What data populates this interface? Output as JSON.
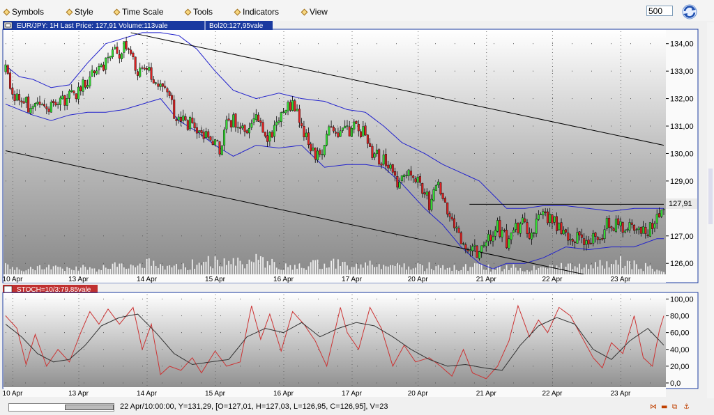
{
  "menu": {
    "items": [
      {
        "label": "Symbols"
      },
      {
        "label": "Style"
      },
      {
        "label": "Time Scale"
      },
      {
        "label": "Tools"
      },
      {
        "label": "Indicators"
      },
      {
        "label": "View"
      }
    ],
    "bars_value": "500"
  },
  "price_panel": {
    "info_label": "EUR/JPY: 1H Last Price: 127,91 Volume:113vale",
    "bol_label": "Bol20:127,95vale",
    "last_price_tag": "127,91"
  },
  "stoch_panel": {
    "info_label": "STOCH=10/3:79,85vale"
  },
  "status": {
    "text": "22 Apr/10:00:00, Y=131,29, [O=127,01, H=127,03, L=126,95, C=126,95], V=23"
  },
  "colors": {
    "up_candle": "#33dd33",
    "down_candle": "#dd2222",
    "bollinger": "#2222cc",
    "panel_border": "#1a3aa0",
    "stoch_fast": "#cc3333",
    "stoch_slow": "#333333"
  },
  "chart_data": [
    {
      "type": "candlestick",
      "x_tick_labels": [
        "10 Apr",
        "13 Apr",
        "14 Apr",
        "15 Apr",
        "16 Apr",
        "17 Apr",
        "20 Apr",
        "21 Apr",
        "22 Apr",
        "23 Apr"
      ],
      "y_tick_labels": [
        "134,00",
        "133,00",
        "132,00",
        "131,00",
        "130,00",
        "129,00",
        "127,00",
        "126,00"
      ],
      "ylim": [
        125.6,
        134.5
      ],
      "last_price": 127.91,
      "close_path": [
        [
          0,
          133.0
        ],
        [
          3,
          132.0
        ],
        [
          8,
          131.9
        ],
        [
          12,
          131.6
        ],
        [
          18,
          131.75
        ],
        [
          25,
          131.85
        ],
        [
          32,
          132.3
        ],
        [
          40,
          133.0
        ],
        [
          47,
          133.6
        ],
        [
          52,
          133.8
        ],
        [
          55,
          133.9
        ],
        [
          58,
          132.9
        ],
        [
          62,
          133.2
        ],
        [
          66,
          132.5
        ],
        [
          70,
          132.4
        ],
        [
          74,
          131.5
        ],
        [
          78,
          131.2
        ],
        [
          84,
          131.0
        ],
        [
          90,
          130.4
        ],
        [
          94,
          130.2
        ],
        [
          98,
          131.3
        ],
        [
          104,
          130.9
        ],
        [
          110,
          131.2
        ],
        [
          116,
          130.6
        ],
        [
          122,
          131.6
        ],
        [
          126,
          131.9
        ],
        [
          130,
          130.9
        ],
        [
          134,
          130.3
        ],
        [
          138,
          129.8
        ],
        [
          142,
          130.8
        ],
        [
          148,
          130.7
        ],
        [
          153,
          131.0
        ],
        [
          158,
          130.7
        ],
        [
          162,
          129.9
        ],
        [
          167,
          129.7
        ],
        [
          172,
          129.0
        ],
        [
          176,
          129.2
        ],
        [
          181,
          129.1
        ],
        [
          186,
          128.2
        ],
        [
          190,
          128.7
        ],
        [
          193,
          128.0
        ],
        [
          197,
          127.4
        ],
        [
          201,
          126.6
        ],
        [
          204,
          126.3
        ],
        [
          208,
          126.5
        ],
        [
          212,
          126.8
        ],
        [
          216,
          127.4
        ],
        [
          220,
          126.8
        ],
        [
          224,
          127.2
        ],
        [
          228,
          127.5
        ],
        [
          231,
          127.0
        ],
        [
          234,
          127.9
        ],
        [
          237,
          127.7
        ],
        [
          241,
          127.5
        ],
        [
          245,
          127.1
        ],
        [
          249,
          127.0
        ],
        [
          253,
          126.9
        ],
        [
          257,
          127.0
        ],
        [
          260,
          126.6
        ],
        [
          264,
          127.6
        ],
        [
          268,
          127.4
        ],
        [
          272,
          127.2
        ],
        [
          277,
          127.3
        ],
        [
          281,
          127.0
        ],
        [
          284,
          127.5
        ],
        [
          287,
          127.8
        ],
        [
          289,
          127.91
        ]
      ],
      "upper_band_path": [
        [
          0,
          133.2
        ],
        [
          6,
          132.8
        ],
        [
          12,
          132.7
        ],
        [
          20,
          132.4
        ],
        [
          28,
          132.5
        ],
        [
          36,
          133.3
        ],
        [
          44,
          134.0
        ],
        [
          52,
          134.2
        ],
        [
          60,
          134.4
        ],
        [
          68,
          134.4
        ],
        [
          76,
          134.3
        ],
        [
          84,
          133.8
        ],
        [
          92,
          133.0
        ],
        [
          100,
          132.3
        ],
        [
          110,
          132.0
        ],
        [
          120,
          132.2
        ],
        [
          130,
          132.0
        ],
        [
          140,
          131.9
        ],
        [
          150,
          131.6
        ],
        [
          158,
          131.5
        ],
        [
          166,
          131.0
        ],
        [
          174,
          130.4
        ],
        [
          184,
          130.0
        ],
        [
          192,
          129.6
        ],
        [
          200,
          129.3
        ],
        [
          208,
          129.0
        ],
        [
          214,
          128.5
        ],
        [
          220,
          128.0
        ],
        [
          228,
          128.0
        ],
        [
          236,
          128.1
        ],
        [
          246,
          128.1
        ],
        [
          256,
          128.0
        ],
        [
          266,
          127.9
        ],
        [
          276,
          128.0
        ],
        [
          286,
          128.0
        ]
      ],
      "lower_band_path": [
        [
          0,
          131.8
        ],
        [
          6,
          131.6
        ],
        [
          12,
          131.4
        ],
        [
          20,
          131.2
        ],
        [
          28,
          131.4
        ],
        [
          36,
          131.5
        ],
        [
          44,
          131.5
        ],
        [
          52,
          131.6
        ],
        [
          60,
          131.8
        ],
        [
          68,
          132.0
        ],
        [
          76,
          131.2
        ],
        [
          84,
          130.8
        ],
        [
          92,
          130.3
        ],
        [
          100,
          129.9
        ],
        [
          110,
          130.3
        ],
        [
          120,
          130.2
        ],
        [
          130,
          130.3
        ],
        [
          140,
          129.5
        ],
        [
          150,
          129.6
        ],
        [
          158,
          129.6
        ],
        [
          166,
          129.5
        ],
        [
          174,
          128.9
        ],
        [
          184,
          128.0
        ],
        [
          192,
          127.4
        ],
        [
          200,
          126.6
        ],
        [
          208,
          126.0
        ],
        [
          214,
          125.8
        ],
        [
          220,
          126.0
        ],
        [
          228,
          126.0
        ],
        [
          236,
          126.2
        ],
        [
          246,
          126.6
        ],
        [
          256,
          126.5
        ],
        [
          266,
          126.6
        ],
        [
          276,
          126.6
        ],
        [
          286,
          126.9
        ]
      ],
      "trendline_upper": [
        [
          55,
          134.4
        ],
        [
          289,
          130.3
        ]
      ],
      "trendline_lower": [
        [
          0,
          130.1
        ],
        [
          257,
          125.6
        ]
      ],
      "horizontal_line": {
        "from": 200,
        "to": 289,
        "y": 128.15
      },
      "volume_path": [
        [
          0,
          15
        ],
        [
          8,
          10
        ],
        [
          16,
          14
        ],
        [
          24,
          9
        ],
        [
          32,
          12
        ],
        [
          40,
          11
        ],
        [
          48,
          16
        ],
        [
          56,
          14
        ],
        [
          64,
          20
        ],
        [
          72,
          13
        ],
        [
          80,
          15
        ],
        [
          88,
          24
        ],
        [
          96,
          18
        ],
        [
          104,
          19
        ],
        [
          112,
          25
        ],
        [
          120,
          14
        ],
        [
          128,
          12
        ],
        [
          136,
          17
        ],
        [
          144,
          18
        ],
        [
          152,
          15
        ],
        [
          160,
          16
        ],
        [
          168,
          14
        ],
        [
          176,
          12
        ],
        [
          184,
          13
        ],
        [
          192,
          15
        ],
        [
          200,
          11
        ],
        [
          208,
          13
        ],
        [
          216,
          9
        ],
        [
          224,
          12
        ],
        [
          232,
          10
        ],
        [
          240,
          12
        ],
        [
          248,
          14
        ],
        [
          256,
          15
        ],
        [
          264,
          18
        ],
        [
          272,
          22
        ],
        [
          280,
          13
        ],
        [
          289,
          9
        ]
      ]
    },
    {
      "type": "line",
      "title": "STOCH",
      "x_tick_labels": [
        "10 Apr",
        "13 Apr",
        "14 Apr",
        "15 Apr",
        "16 Apr",
        "17 Apr",
        "20 Apr",
        "21 Apr",
        "22 Apr",
        "23 Apr"
      ],
      "y_tick_labels": [
        "100,00",
        "80,00",
        "60,00",
        "40,00",
        "20,00",
        "0,0"
      ],
      "ylim": [
        -5,
        107
      ],
      "series": [
        {
          "values": [
            [
              0,
              80
            ],
            [
              5,
              65
            ],
            [
              9,
              22
            ],
            [
              13,
              58
            ],
            [
              18,
              20
            ],
            [
              23,
              40
            ],
            [
              28,
              25
            ],
            [
              33,
              60
            ],
            [
              37,
              85
            ],
            [
              41,
              70
            ],
            [
              45,
              88
            ],
            [
              50,
              70
            ],
            [
              56,
              90
            ],
            [
              60,
              40
            ],
            [
              64,
              70
            ],
            [
              68,
              10
            ],
            [
              72,
              20
            ],
            [
              77,
              15
            ],
            [
              82,
              30
            ],
            [
              86,
              12
            ],
            [
              92,
              38
            ],
            [
              97,
              20
            ],
            [
              103,
              25
            ],
            [
              108,
              92
            ],
            [
              112,
              52
            ],
            [
              116,
              82
            ],
            [
              121,
              38
            ],
            [
              126,
              85
            ],
            [
              131,
              70
            ],
            [
              136,
              50
            ],
            [
              141,
              20
            ],
            [
              147,
              90
            ],
            [
              150,
              60
            ],
            [
              155,
              40
            ],
            [
              160,
              90
            ],
            [
              165,
              65
            ],
            [
              170,
              20
            ],
            [
              175,
              45
            ],
            [
              180,
              25
            ],
            [
              186,
              30
            ],
            [
              191,
              20
            ],
            [
              196,
              8
            ],
            [
              201,
              40
            ],
            [
              205,
              12
            ],
            [
              211,
              5
            ],
            [
              216,
              20
            ],
            [
              221,
              50
            ],
            [
              225,
              92
            ],
            [
              230,
              55
            ],
            [
              234,
              75
            ],
            [
              238,
              60
            ],
            [
              243,
              90
            ],
            [
              248,
              80
            ],
            [
              253,
              55
            ],
            [
              258,
              30
            ],
            [
              262,
              18
            ],
            [
              266,
              48
            ],
            [
              271,
              35
            ],
            [
              276,
              80
            ],
            [
              280,
              30
            ],
            [
              284,
              20
            ],
            [
              287,
              62
            ],
            [
              289,
              80
            ]
          ]
        },
        {
          "values": [
            [
              0,
              70
            ],
            [
              7,
              55
            ],
            [
              14,
              35
            ],
            [
              21,
              25
            ],
            [
              28,
              28
            ],
            [
              35,
              45
            ],
            [
              42,
              68
            ],
            [
              50,
              78
            ],
            [
              58,
              82
            ],
            [
              66,
              60
            ],
            [
              74,
              35
            ],
            [
              82,
              22
            ],
            [
              90,
              25
            ],
            [
              98,
              28
            ],
            [
              106,
              55
            ],
            [
              114,
              65
            ],
            [
              122,
              60
            ],
            [
              130,
              72
            ],
            [
              138,
              55
            ],
            [
              146,
              65
            ],
            [
              154,
              72
            ],
            [
              162,
              68
            ],
            [
              170,
              55
            ],
            [
              178,
              40
            ],
            [
              186,
              28
            ],
            [
              194,
              20
            ],
            [
              202,
              22
            ],
            [
              210,
              18
            ],
            [
              218,
              15
            ],
            [
              226,
              45
            ],
            [
              234,
              68
            ],
            [
              242,
              78
            ],
            [
              250,
              70
            ],
            [
              258,
              40
            ],
            [
              266,
              28
            ],
            [
              274,
              50
            ],
            [
              282,
              65
            ],
            [
              289,
              45
            ]
          ]
        }
      ]
    }
  ]
}
